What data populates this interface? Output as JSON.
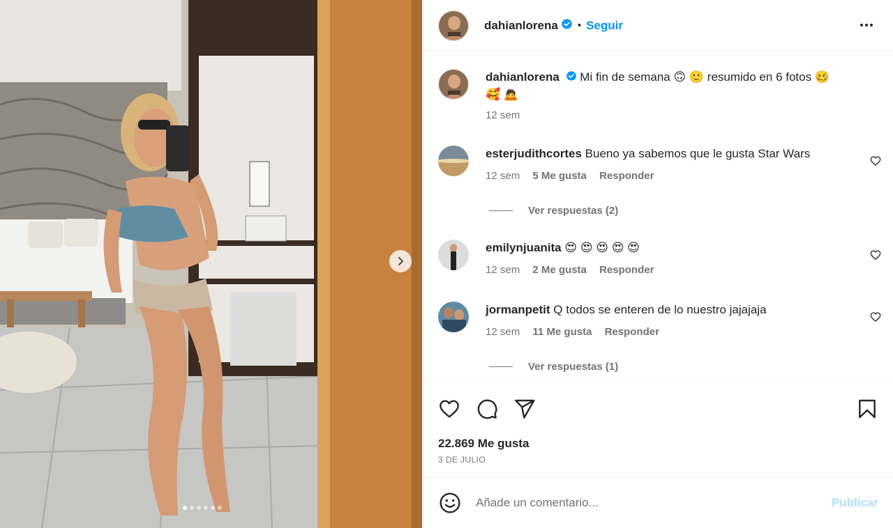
{
  "post": {
    "username": "dahianlorena",
    "follow_label": "Seguir",
    "separator": "•",
    "caption_text": "Mi fin de semana 🙃 🙂 resumido en 6 fotos 🥴",
    "caption_text_line2": "🥰 🙇",
    "caption_time": "12 sem",
    "likes": "22.869 Me gusta",
    "date": "3 DE JULIO",
    "carousel": {
      "current": 1,
      "total": 6
    }
  },
  "comments": [
    {
      "username": "esterjudithcortes",
      "text": "Bueno ya sabemos que le gusta Star Wars",
      "time": "12 sem",
      "likes": "5 Me gusta",
      "reply": "Responder",
      "replies": "Ver respuestas (2)"
    },
    {
      "username": "emilynjuanita",
      "text": "😍 😍 😍 😍 😍",
      "time": "12 sem",
      "likes": "2 Me gusta",
      "reply": "Responder"
    },
    {
      "username": "jormanpetit",
      "text": "Q todos se enteren de lo nuestro jajajaja",
      "time": "12 sem",
      "likes": "11 Me gusta",
      "reply": "Responder",
      "replies": "Ver respuestas (1)"
    }
  ],
  "composer": {
    "placeholder": "Añade un comentario...",
    "publish": "Publicar"
  },
  "colors": {
    "accent": "#0095f6",
    "publish_disabled": "#b2dffc",
    "muted": "#737373"
  },
  "icons": [
    "more-options-icon",
    "verified-badge-icon",
    "heart-icon",
    "comment-icon",
    "share-icon",
    "bookmark-icon",
    "emoji-icon",
    "chevron-right-icon"
  ]
}
